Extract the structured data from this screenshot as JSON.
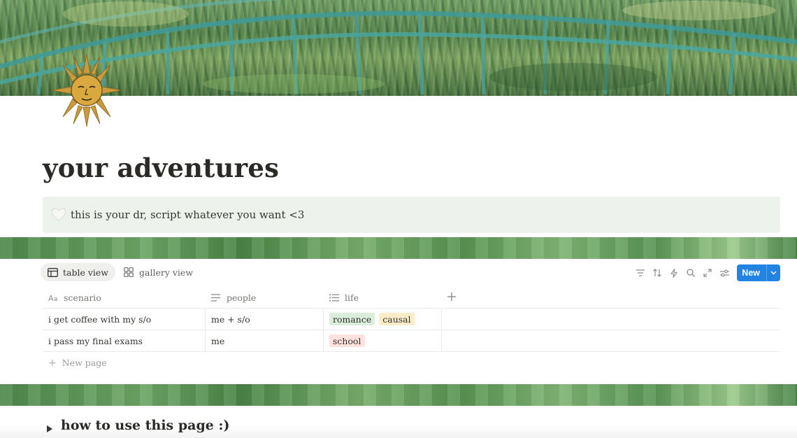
{
  "page": {
    "title": "your adventures",
    "icon": "sun-face-icon",
    "cover": "painting-bridge-cover"
  },
  "callout": {
    "icon": "white-heart-icon",
    "text": "this is your dr, script whatever you want <3",
    "background": "#edf3ec"
  },
  "views": [
    {
      "label": "table view",
      "icon": "table-icon",
      "active": true
    },
    {
      "label": "gallery view",
      "icon": "gallery-icon",
      "active": false
    }
  ],
  "toolbar": {
    "icons": [
      "filter-icon",
      "sort-icon",
      "automation-lightning-icon",
      "search-icon",
      "expand-icon",
      "settings-sliders-icon"
    ],
    "new_label": "New",
    "accent": "#2383e2"
  },
  "table": {
    "columns": [
      {
        "label": "scenario",
        "icon": "text-aa-icon"
      },
      {
        "label": "people",
        "icon": "text-lines-icon"
      },
      {
        "label": "life",
        "icon": "multi-select-list-icon"
      }
    ],
    "rows": [
      {
        "scenario": "i get coffee with my s/o",
        "people": "me + s/o",
        "life": [
          {
            "label": "romance",
            "color": "#dbeddb"
          },
          {
            "label": "causal",
            "color": "#fdecc8"
          }
        ]
      },
      {
        "scenario": "i pass my final exams",
        "people": "me",
        "life": [
          {
            "label": "school",
            "color": "#ffe2dd"
          }
        ]
      }
    ],
    "new_page_label": "New page"
  },
  "toggle": {
    "text": "how to use this page :)"
  }
}
